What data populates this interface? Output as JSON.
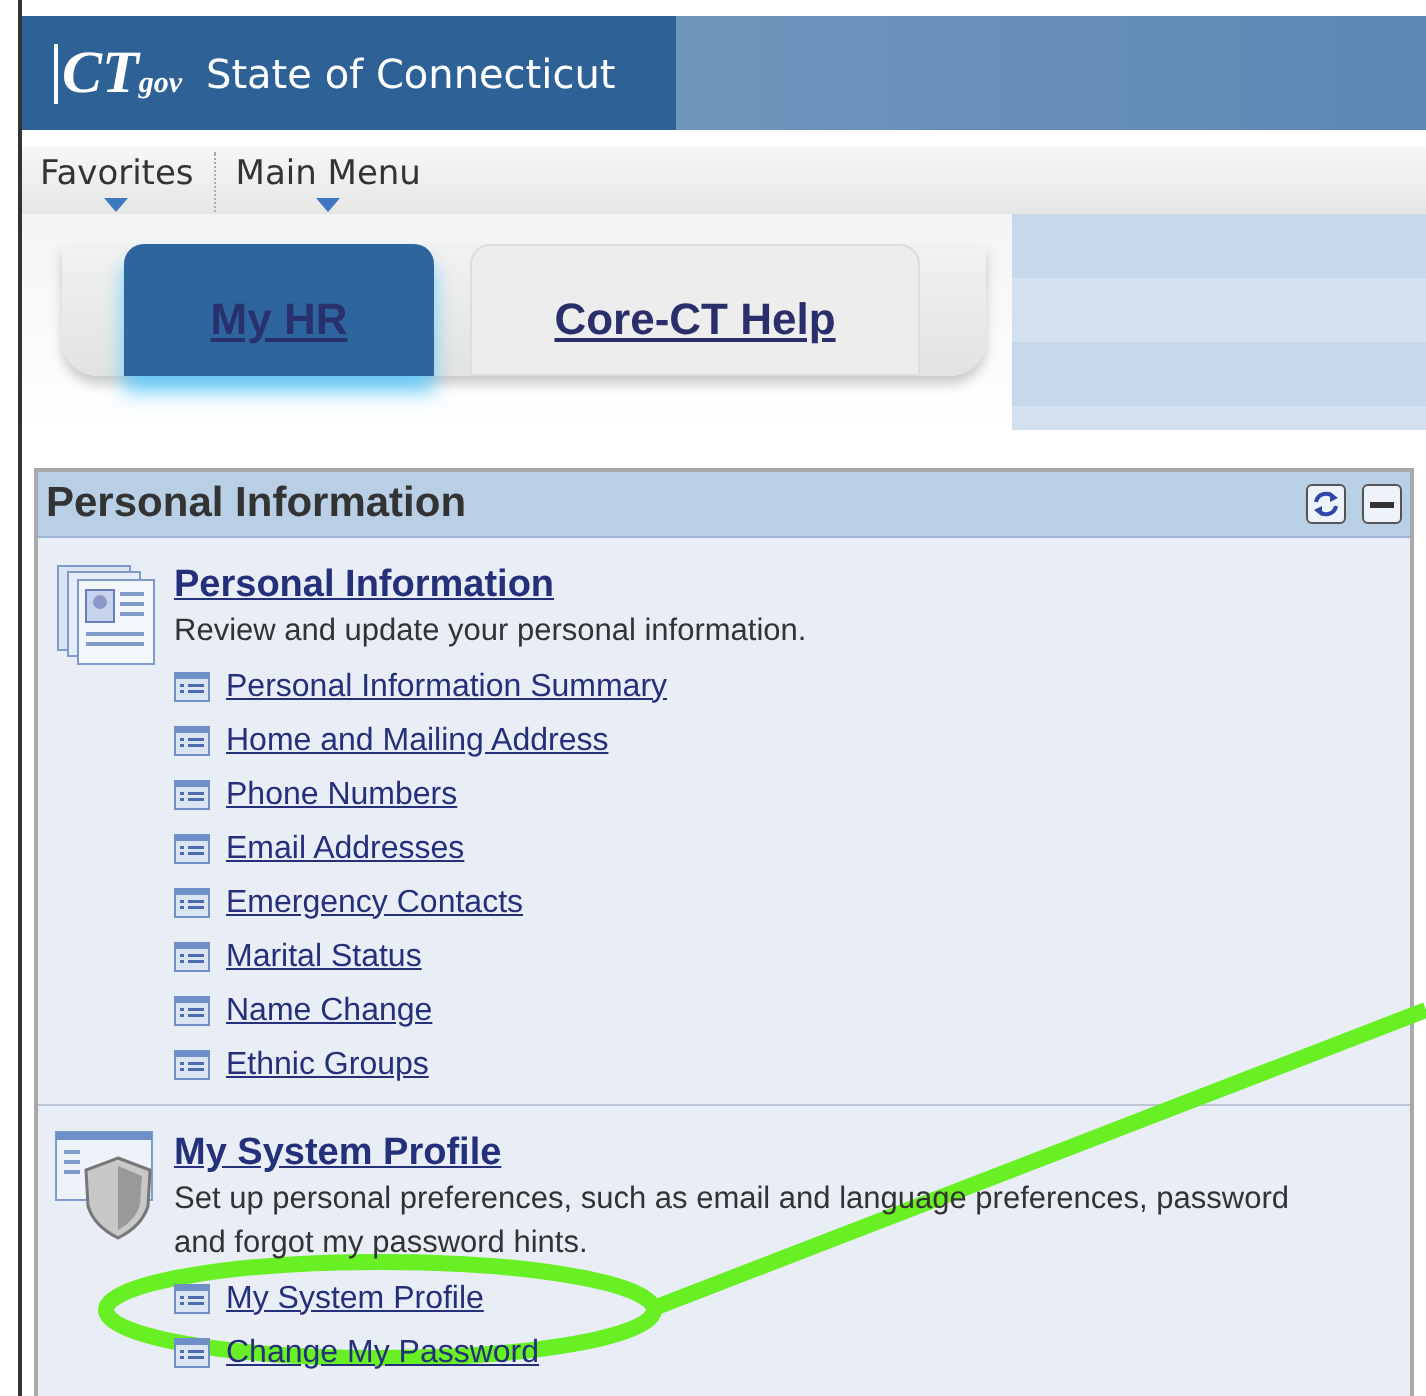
{
  "header": {
    "logo": "CT",
    "logo_suffix": "gov",
    "site_title": "State of Connecticut"
  },
  "menu": [
    {
      "label": "Favorites"
    },
    {
      "label": "Main Menu"
    }
  ],
  "tabs": [
    {
      "label": "My HR",
      "selected": true
    },
    {
      "label": "Core-CT Help",
      "selected": false
    }
  ],
  "pagelet": {
    "title": "Personal Information",
    "groups": [
      {
        "kind": "personal",
        "title": "Personal Information",
        "description": "Review and update your personal information.",
        "links": [
          "Personal Information Summary",
          "Home and Mailing Address",
          "Phone Numbers",
          "Email Addresses",
          "Emergency Contacts",
          "Marital Status",
          "Name Change",
          "Ethnic Groups"
        ]
      },
      {
        "kind": "profile",
        "title": "My System Profile",
        "description": "Set up personal preferences, such as email and language preferences, password and forgot my password hints.",
        "links": [
          "My System Profile",
          "Change My Password"
        ]
      }
    ]
  }
}
